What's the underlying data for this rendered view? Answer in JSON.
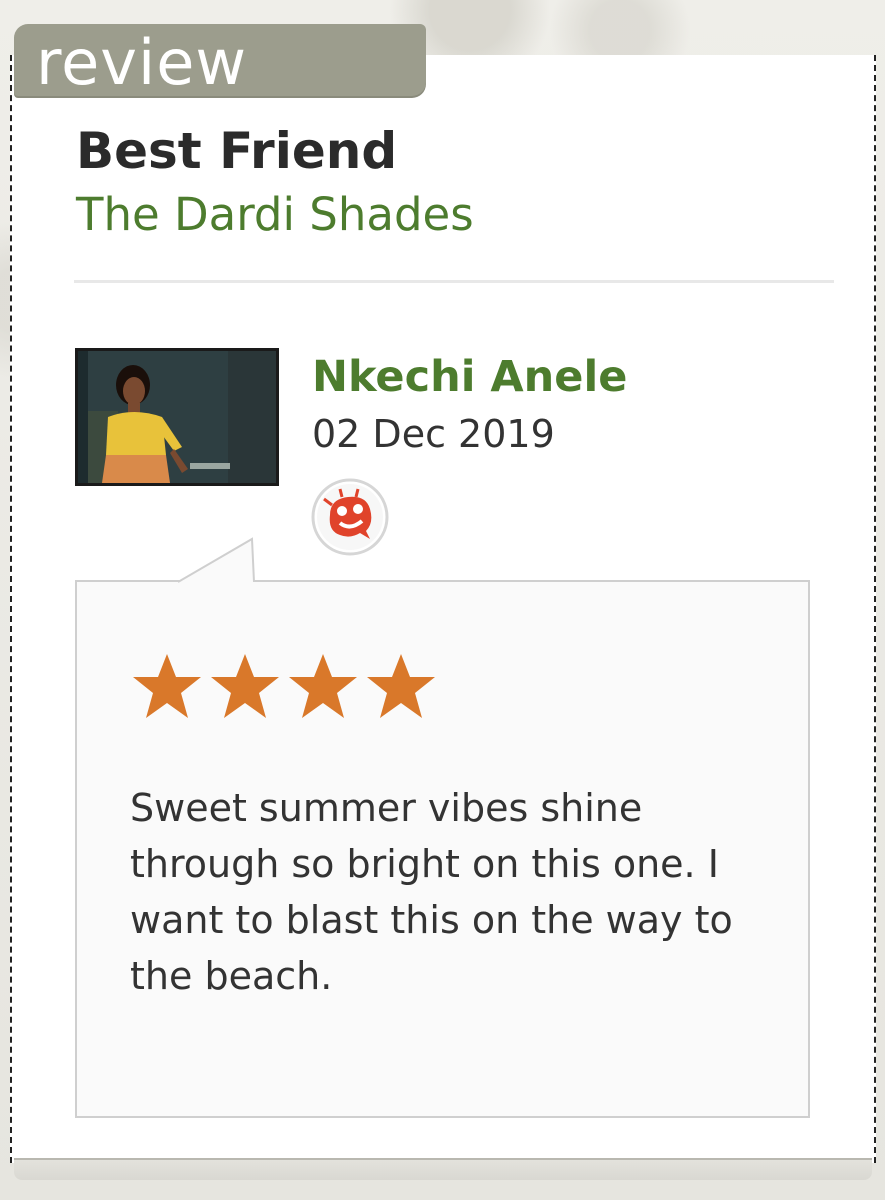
{
  "tab": {
    "label": "review"
  },
  "song": {
    "title": "Best Friend",
    "artist": "The Dardi Shades"
  },
  "reviewer": {
    "name": "Nkechi Anele",
    "date": "02 Dec 2019",
    "avatar_icon": "reviewer-photo",
    "station_icon": "triple-j-logo-icon"
  },
  "review": {
    "rating": 4,
    "rating_max": 4,
    "text": "Sweet summer vibes shine through so bright on this one. I want to blast this on the way to the beach."
  },
  "colors": {
    "accent_green": "#4d7c2e",
    "star_orange": "#d9782a",
    "tab_gray": "#9c9d8d"
  }
}
